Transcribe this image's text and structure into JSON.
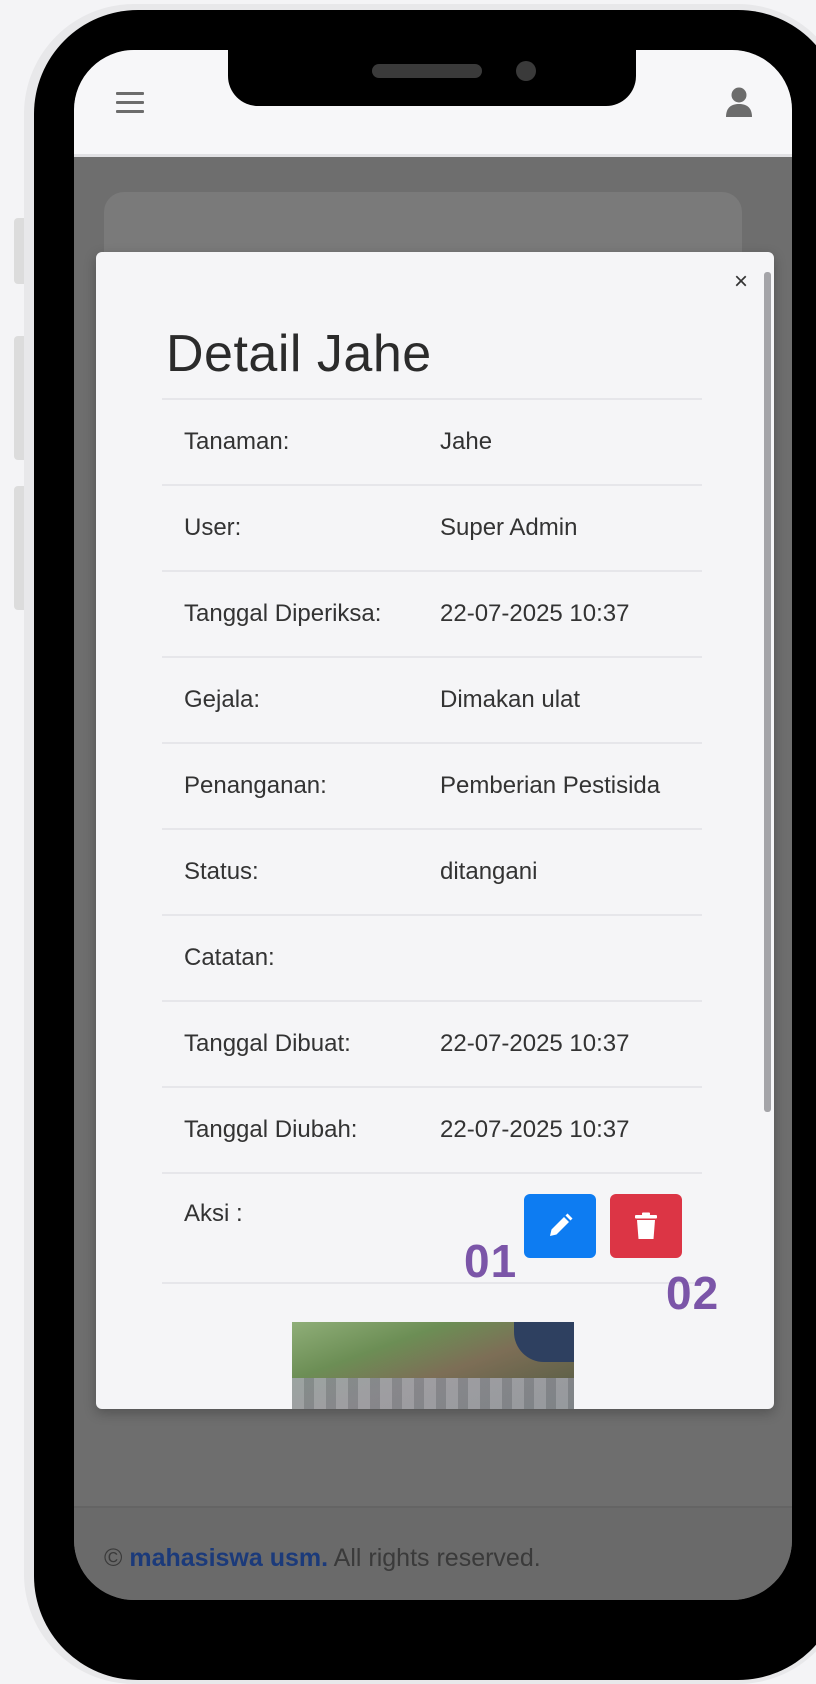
{
  "modal": {
    "close_label": "×",
    "title": "Detail Jahe",
    "rows": [
      {
        "label": "Tanaman:",
        "value": "Jahe"
      },
      {
        "label": "User:",
        "value": "Super Admin"
      },
      {
        "label": "Tanggal Diperiksa:",
        "value": "22-07-2025 10:37"
      },
      {
        "label": "Gejala:",
        "value": "Dimakan ulat"
      },
      {
        "label": "Penanganan:",
        "value": "Pemberian Pestisida"
      },
      {
        "label": "Status:",
        "value": "ditangani"
      },
      {
        "label": "Catatan:",
        "value": ""
      },
      {
        "label": "Tanggal Dibuat:",
        "value": "22-07-2025 10:37"
      },
      {
        "label": "Tanggal Diubah:",
        "value": "22-07-2025 10:37"
      }
    ],
    "action_label": "Aksi :"
  },
  "annotations": {
    "edit": "01",
    "delete": "02"
  },
  "footer": {
    "copyright": "©",
    "brand": "mahasiswa usm.",
    "rights": " All rights reserved."
  },
  "icons": {
    "menu": "hamburger-icon",
    "user": "user-icon",
    "edit": "pencil-icon",
    "delete": "trash-icon",
    "close": "close-icon"
  },
  "colors": {
    "edit_button": "#0d7cf2",
    "delete_button": "#dc3545",
    "annotation": "#7b55a8",
    "brand": "#1b3a7a"
  }
}
